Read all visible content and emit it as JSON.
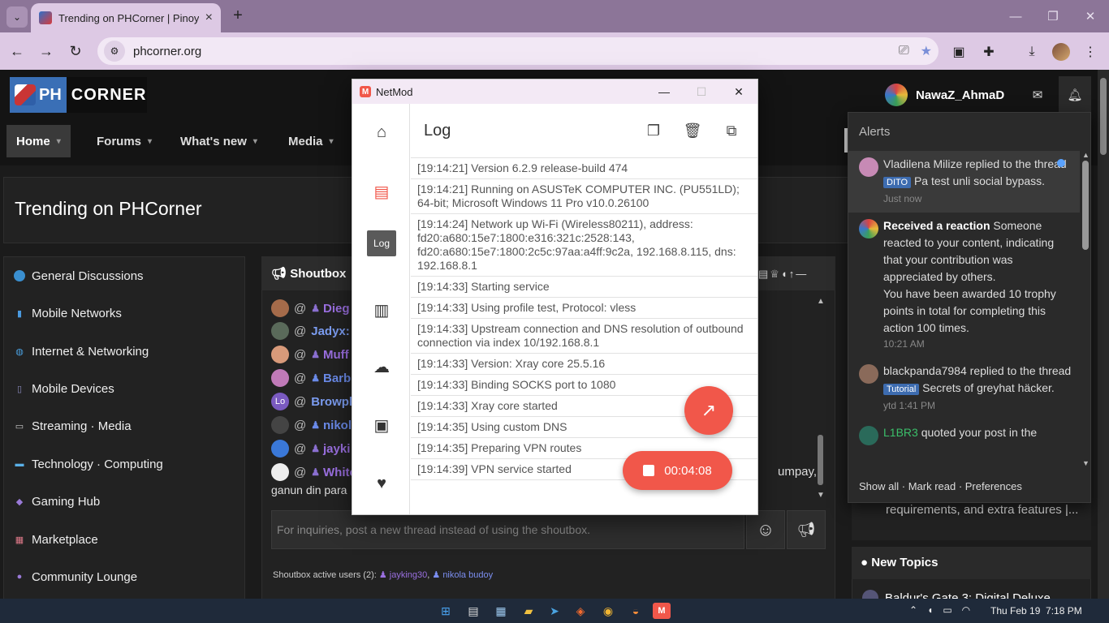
{
  "browser": {
    "tab_title": "Trending on PHCorner | Pinoy I",
    "url": "phcorner.org"
  },
  "site": {
    "logo_ph": "PH",
    "logo_corner": "CORNER",
    "username": "NawaZ_AhmaD",
    "nav": [
      "Home",
      "Forums",
      "What's new",
      "Media"
    ],
    "page_title": "Trending on PHCorner",
    "sidebar": [
      "General Discussions",
      "Mobile Networks",
      "Internet & Networking",
      "Mobile Devices",
      "Streaming · Media",
      "Technology · Computing",
      "Gaming Hub",
      "Marketplace",
      "Community Lounge"
    ],
    "shoutbox": {
      "title": "Shoutbox",
      "rows": [
        "Dieg",
        "Jadyx:",
        "Muff",
        "Barb",
        "Browph",
        "nikol",
        "jayki",
        "White"
      ],
      "tail_right": "umpay,",
      "tail": "ganun din para",
      "placeholder": "For inquiries, post a new thread instead of using the shoutbox.",
      "active_label": "Shoutbox active users (2):",
      "active_users": [
        "jayking30",
        "nikola budoy"
      ]
    },
    "right_stub": "requirements, and extra features |...",
    "new_topics": {
      "title": "New Topics",
      "first": "Baldur's Gate 3: Digital Deluxe"
    }
  },
  "alerts": {
    "title": "Alerts",
    "items": [
      {
        "user": "Vladilena Milize",
        "before": "replied to the thread",
        "tag": "DITO",
        "after": "Pa test unli social bypass.",
        "time": "Just now"
      },
      {
        "user": "Received a reaction",
        "before": "Someone reacted to your content, indicating that your contribution was appreciated by others.",
        "extra": "You have been awarded 10 trophy points in total for completing this action 100 times.",
        "time": "10:21 AM"
      },
      {
        "user": "blackpanda7984",
        "before": "replied to the thread",
        "tag": "Tutorial",
        "after": "Secrets of greyhat häcker.",
        "time": "ytd 1:41 PM"
      },
      {
        "user": "L1BR3",
        "before": "quoted your post in the"
      }
    ],
    "footer": "Show all · Mark read · Preferences"
  },
  "netmod": {
    "app_title": "NetMod",
    "log_title": "Log",
    "nav_log_label": "Log",
    "log_lines": [
      "[19:14:21] Version 6.2.9 release-build 474",
      "[19:14:21] Running on ASUSTeK COMPUTER INC. (PU551LD); 64-bit; Microsoft Windows 11 Pro v10.0.26100",
      "[19:14:24] Network up Wi-Fi (Wireless80211), address: fd20:a680:15e7:1800:e316:321c:2528:143, fd20:a680:15e7:1800:2c5c:97aa:a4ff:9c2a, 192.168.8.115, dns: 192.168.8.1",
      "[19:14:33] Starting service",
      "[19:14:33] Using profile test, Protocol: vless",
      "[19:14:33] Upstream connection and DNS resolution of outbound connection via index 10/192.168.8.1",
      "[19:14:33] Version: Xray core 25.5.16",
      "[19:14:33] Binding SOCKS port to 1080",
      "[19:14:33] Xray core started",
      "[19:14:35] Using custom DNS",
      "[19:14:35] Preparing VPN routes",
      "[19:14:39] VPN service started"
    ],
    "timer": "00:04:08"
  },
  "taskbar": {
    "date": "Thu Feb 19",
    "time": "7:18 PM"
  },
  "colors": {
    "accent": "#f1574a",
    "tab_strip": "#8c7598",
    "toolbar": "#ddc9e4",
    "site_bg": "#1b1b1b",
    "tag_blue": "#3d6cb0"
  }
}
